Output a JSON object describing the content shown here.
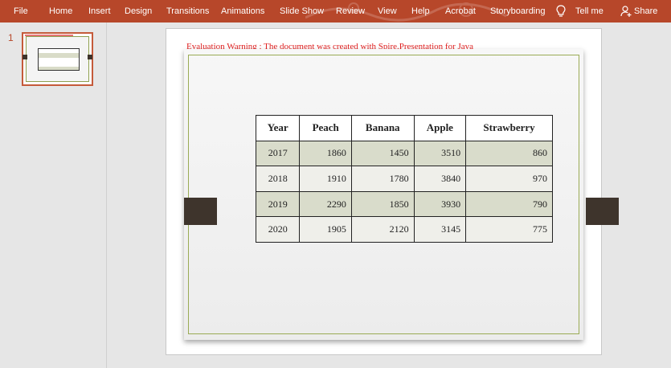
{
  "ribbon": {
    "tabs": [
      "File",
      "Home",
      "Insert",
      "Design",
      "Transitions",
      "Animations",
      "Slide Show",
      "Review",
      "View",
      "Help",
      "Acrobat",
      "Storyboarding"
    ],
    "tell_me": "Tell me",
    "share": "Share",
    "accent": "#b7472a"
  },
  "thumbnails": {
    "slide_number": "1"
  },
  "slide": {
    "warning": "Evaluation Warning : The document was created with  Spire.Presentation for Java",
    "table": {
      "headers": [
        "Year",
        "Peach",
        "Banana",
        "Apple",
        "Strawberry"
      ],
      "rows": [
        [
          "2017",
          "1860",
          "1450",
          "3510",
          "860"
        ],
        [
          "2018",
          "1910",
          "1780",
          "3840",
          "970"
        ],
        [
          "2019",
          "2290",
          "1850",
          "3930",
          "790"
        ],
        [
          "2020",
          "1905",
          "2120",
          "3145",
          "775"
        ]
      ]
    }
  }
}
